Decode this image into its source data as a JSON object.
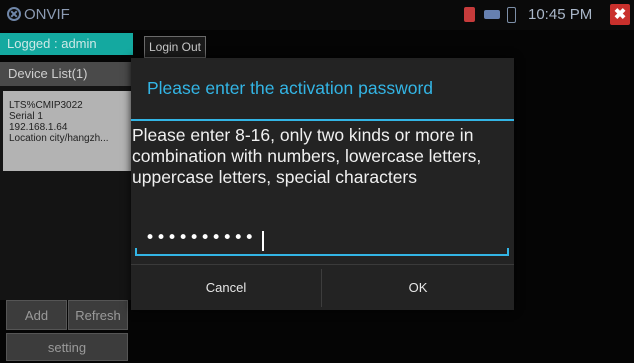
{
  "status_bar": {
    "app_title": "ONVIF",
    "time": "10:45 PM",
    "icons": [
      "app-logo-icon",
      "alert-icon",
      "usb-icon",
      "battery-icon",
      "close-icon"
    ],
    "close_glyph": "✖",
    "colors": {
      "close": "#c9302c",
      "alert": "#c63b3b"
    }
  },
  "sidebar": {
    "logged_label": "Logged : admin",
    "device_list_label": "Device List(1)",
    "device": {
      "name": "LTS%CMIP3022",
      "serial": "Serial  1",
      "ip": "192.168.1.64",
      "location": "Location  city/hangzh..."
    },
    "add_label": "Add",
    "refresh_label": "Refresh",
    "setting_label": "setting"
  },
  "toolbar": {
    "login_out_label": "Login Out"
  },
  "dialog": {
    "title": "Please enter the activation password",
    "message": "Please enter 8-16, only two kinds or more in combination with numbers, lowercase letters, uppercase letters, special characters",
    "password_masked": "••••••••••",
    "cancel_label": "Cancel",
    "ok_label": "OK",
    "accent_color": "#33b5e5"
  }
}
